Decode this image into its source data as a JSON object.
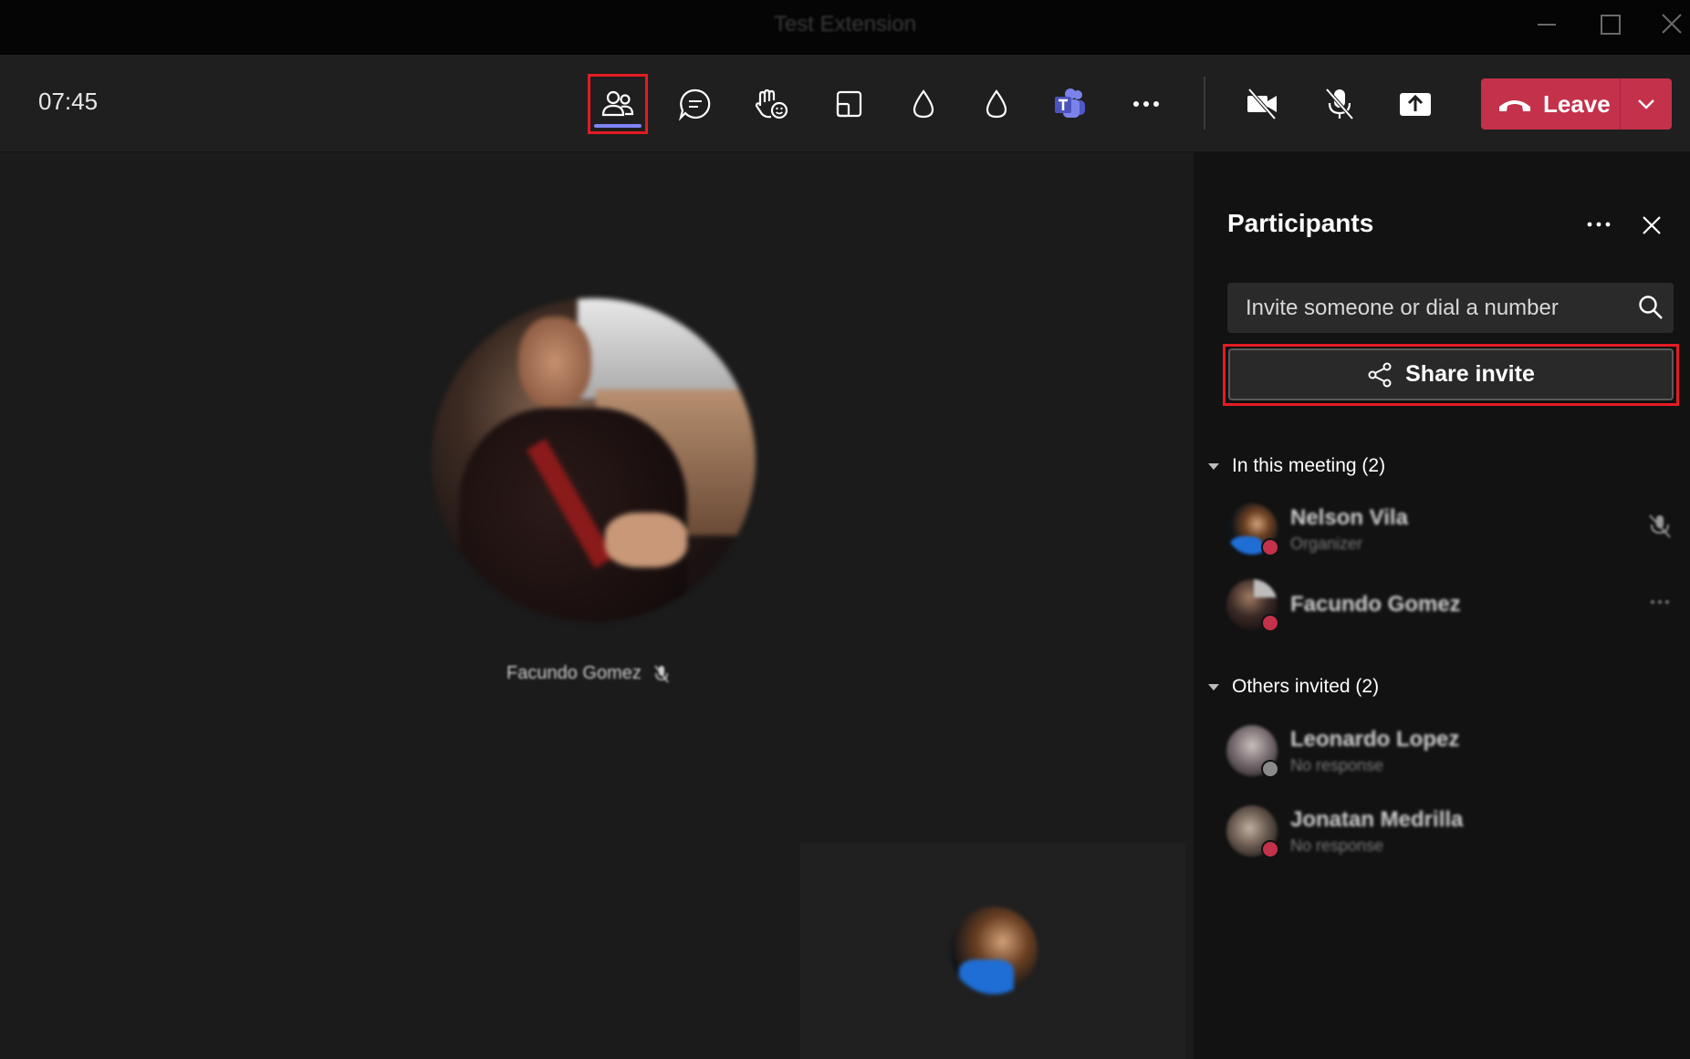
{
  "window": {
    "title": "Test Extension"
  },
  "toolbar": {
    "timer": "07:45",
    "leave_label": "Leave",
    "buttons": [
      {
        "name": "participants-button",
        "icon": "people-icon",
        "active": true
      },
      {
        "name": "chat-button",
        "icon": "chat-icon"
      },
      {
        "name": "reactions-button",
        "icon": "raise-hand-icon"
      },
      {
        "name": "view-button",
        "icon": "view-icon"
      },
      {
        "name": "extension-1-button",
        "icon": "drop-icon"
      },
      {
        "name": "extension-2-button",
        "icon": "drop-icon"
      },
      {
        "name": "teams-app-button",
        "icon": "teams-logo-icon"
      },
      {
        "name": "more-actions-button",
        "icon": "more-icon"
      },
      {
        "name": "camera-button",
        "icon": "camera-off-icon"
      },
      {
        "name": "mic-button",
        "icon": "mic-off-icon"
      },
      {
        "name": "share-screen-button",
        "icon": "share-tray-icon"
      }
    ]
  },
  "stage": {
    "main_participant": "Facundo Gomez"
  },
  "panel": {
    "title": "Participants",
    "search_placeholder": "Invite someone or dial a number",
    "share_invite_label": "Share invite",
    "sections": [
      {
        "label": "In this meeting (2)",
        "people": [
          {
            "name": "Nelson Vila",
            "status": "Organizer",
            "presence_color": "#c4314b"
          },
          {
            "name": "Facundo Gomez",
            "status": "",
            "presence_color": "#c4314b"
          }
        ]
      },
      {
        "label": "Others invited (2)",
        "people": [
          {
            "name": "Leonardo Lopez",
            "status": "No response",
            "presence_color": "#8a8a8a"
          },
          {
            "name": "Jonatan Medrilla",
            "status": "No response",
            "presence_color": "#c4314b"
          }
        ]
      }
    ]
  },
  "colors": {
    "accent": "#7f85f5",
    "leave": "#c4314b",
    "highlight": "#e41b23"
  }
}
